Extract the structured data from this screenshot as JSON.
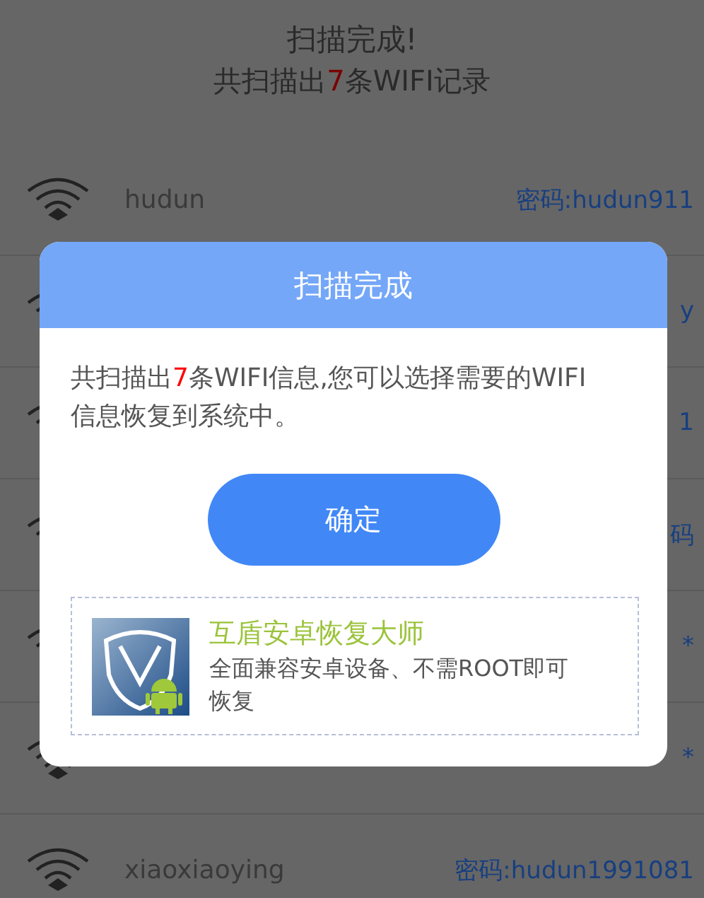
{
  "header": {
    "title": "扫描完成!",
    "summary": "共扫描出**7**条WIFI记录"
  },
  "networks": [
    {
      "name": "hudun",
      "password": "密码:hudun911"
    },
    {
      "password": "y"
    },
    {
      "password": "1"
    },
    {
      "password": "码"
    },
    {
      "password": "*"
    },
    {
      "password": "*"
    },
    {
      "name": "xiaoxiaoying",
      "password": "密码:hudun1991081"
    }
  ],
  "dialog": {
    "title": "扫描完成",
    "message": "共扫描出**7**条WIFI信息,您可以选择需要的WIFI信息恢复到系统中。",
    "button": "确定",
    "promo": {
      "title": "互盾安卓恢复大师",
      "description": "全面兼容安卓设备、不需ROOT即可恢复"
    }
  }
}
